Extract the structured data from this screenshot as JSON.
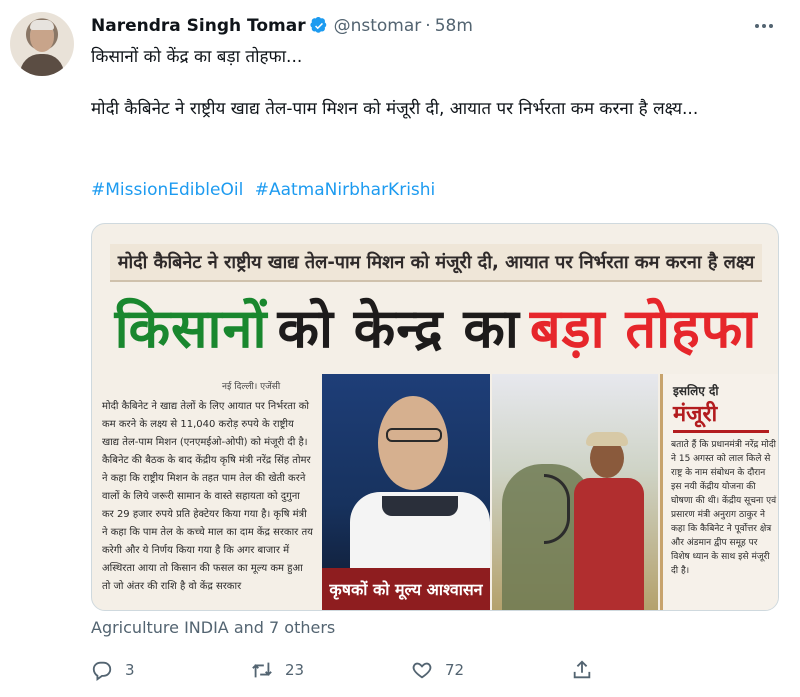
{
  "author": {
    "name": "Narendra Singh Tomar",
    "handle": "@nstomar",
    "dot": "·",
    "time": "58m"
  },
  "tweet": {
    "line1": "किसानों को केंद्र का बड़ा तोहफा...",
    "line2": "मोदी कैबिनेट ने राष्ट्रीय खाद्य तेल-पाम मिशन को मंजूरी दी, आयात पर निर्भरता कम करना है लक्ष्य...",
    "hashtags": [
      "#MissionEdibleOil",
      "#AatmaNirbharKrishi"
    ]
  },
  "media": {
    "subhead": "मोदी कैबिनेट ने राष्ट्रीय खाद्य तेल-पाम मिशन को मंजूरी दी, आयात पर निर्भरता कम करना है लक्ष्य",
    "headline": {
      "part1": "किसानों",
      "part2": "को केन्द्र का",
      "part3": "बड़ा तोहफा"
    },
    "byline": "नई दिल्ली। एजेंसी",
    "body_paragraph": "मोदी कैबिनेट ने खाद्य तेलों के लिए आयात पर निर्भरता को कम करने के लक्ष्य से 11,040 करोड़ रुपये के राष्ट्रीय खाद्य तेल-पाम मिशन (एनएमईओ-ओपी) को मंजूरी दी है। कैबिनेट की बैठक के बाद केंद्रीय कृषि मंत्री नरेंद्र सिंह तोमर ने कहा कि राष्ट्रीय मिशन के तहत पाम तेल की खेती करने वालों के लिये जरूरी सामान के वास्ते सहायता को दुगुना कर 29 हजार रुपये प्रति हेक्टेयर किया गया है। कृषि मंत्री ने कहा कि पाम तेल के कच्चे माल का दाम केंद्र सरकार तय करेगी और ये निर्णय किया गया है कि अगर बाजार में अस्थिरता आया तो किसान की फसल का मूल्य कम हुआ तो जो अंतर की राशि है वो केंद्र सरकार",
    "photo_caption": "कृषकों को मूल्य आश्वासन",
    "sidebar_tag": "इसलिए दी",
    "sidebar_big": "मंजूरी",
    "sidebar_text": "बताते हैं कि प्रधानमंत्री नरेंद्र मोदी ने 15 अगस्त को लाल किले से राष्ट्र के नाम संबोधन के दौरान इस नयी केंद्रीय योजना की घोषणा की थी। केंद्रीय सूचना एवं प्रसारण मंत्री अनुराग ठाकुर ने कहा कि कैबिनेट ने पूर्वोत्तर क्षेत्र और अंडमान द्वीप समूह पर विशेष ध्यान के साथ इसे मंजूरी दी है।"
  },
  "reply_context": "Agriculture INDIA and 7 others",
  "actions": {
    "reply_count": "3",
    "retweet_count": "23",
    "like_count": "72",
    "share_count": ""
  },
  "colors": {
    "accent": "#1d9bf0",
    "muted": "#536471",
    "verified": "#1d9bf0",
    "headline_green": "#19872e",
    "headline_red": "#e6262b"
  }
}
